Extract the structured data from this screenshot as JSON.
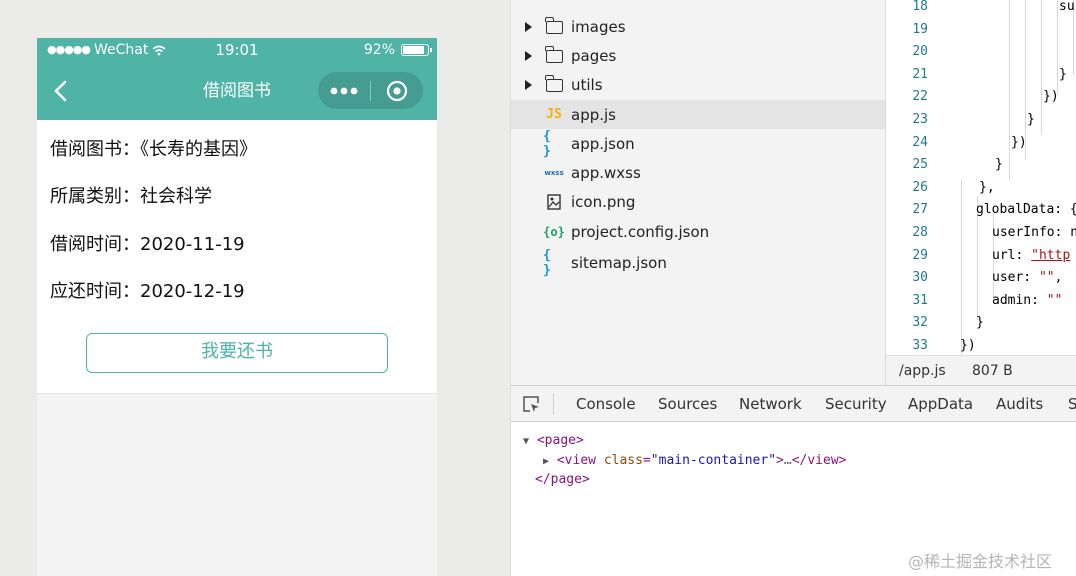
{
  "simulator": {
    "status_bar": {
      "carrier_dots": "●●●●●",
      "carrier": "WeChat",
      "time": "19:01",
      "battery_text": "92%",
      "battery_level": 0.92
    },
    "nav": {
      "title": "借阅图书"
    },
    "rows": [
      {
        "text": "借阅图书：《长寿的基因》"
      },
      {
        "text": "所属类别：社会科学"
      },
      {
        "text": "借阅时间：2020-11-19"
      },
      {
        "text": "应还时间：2020-12-19"
      }
    ],
    "return_button": "我要还书"
  },
  "file_tree": {
    "items": [
      {
        "label": "images",
        "type": "folder",
        "icon": "folder-icon"
      },
      {
        "label": "pages",
        "type": "folder",
        "icon": "folder-icon"
      },
      {
        "label": "utils",
        "type": "folder",
        "icon": "folder-icon"
      },
      {
        "label": "app.js",
        "type": "file",
        "icon": "js-file-icon",
        "icon_text": "JS",
        "selected": true
      },
      {
        "label": "app.json",
        "type": "file",
        "icon": "json-file-icon",
        "icon_text": "{ }"
      },
      {
        "label": "app.wxss",
        "type": "file",
        "icon": "wxss-file-icon",
        "icon_text": "wxss"
      },
      {
        "label": "icon.png",
        "type": "file",
        "icon": "image-file-icon"
      },
      {
        "label": "project.config.json",
        "type": "file",
        "icon": "config-file-icon",
        "icon_text": "{o}"
      },
      {
        "label": "sitemap.json",
        "type": "file",
        "icon": "json-file-icon",
        "icon_text": "{ }"
      }
    ]
  },
  "editor": {
    "lines": [
      {
        "num": "18",
        "parts": [
          {
            "t": "su",
            "c": ""
          }
        ]
      },
      {
        "num": "19",
        "parts": [
          {
            "t": "",
            "c": ""
          }
        ]
      },
      {
        "num": "20",
        "parts": [
          {
            "t": "",
            "c": ""
          }
        ]
      },
      {
        "num": "21",
        "parts": [
          {
            "t": "}",
            "c": ""
          }
        ]
      },
      {
        "num": "22",
        "parts": [
          {
            "t": "})",
            "c": ""
          }
        ]
      },
      {
        "num": "23",
        "parts": [
          {
            "t": "}",
            "c": ""
          }
        ]
      },
      {
        "num": "24",
        "parts": [
          {
            "t": "})",
            "c": ""
          }
        ]
      },
      {
        "num": "25",
        "parts": [
          {
            "t": "}",
            "c": ""
          }
        ]
      },
      {
        "num": "26",
        "parts": [
          {
            "t": "},",
            "c": ""
          }
        ]
      },
      {
        "num": "27",
        "parts": [
          {
            "t": "globalData: {",
            "c": ""
          }
        ]
      },
      {
        "num": "28",
        "parts": [
          {
            "t": "userInfo: n",
            "c": ""
          }
        ]
      },
      {
        "num": "29",
        "parts": [
          {
            "t": "url: ",
            "c": ""
          },
          {
            "t": "\"http",
            "c": "url-str"
          }
        ]
      },
      {
        "num": "30",
        "parts": [
          {
            "t": "user: ",
            "c": ""
          },
          {
            "t": "\"\"",
            "c": "str"
          },
          {
            "t": ",",
            "c": ""
          }
        ]
      },
      {
        "num": "31",
        "parts": [
          {
            "t": "admin: ",
            "c": ""
          },
          {
            "t": "\"\"",
            "c": "str"
          }
        ]
      },
      {
        "num": "32",
        "parts": [
          {
            "t": "}",
            "c": ""
          }
        ]
      },
      {
        "num": "33",
        "parts": [
          {
            "t": "})",
            "c": ""
          }
        ]
      }
    ],
    "status": {
      "path": "/app.js",
      "size": "807 B"
    }
  },
  "devtools": {
    "tabs": [
      "Console",
      "Sources",
      "Network",
      "Security",
      "AppData",
      "Audits",
      "Sensor"
    ],
    "elements": {
      "page_open": "<page>",
      "view_open": "<view",
      "attr_name": "class",
      "attr_value": "\"main-container\"",
      "ellipsis": "…",
      "view_close": "</view>",
      "page_close": "</page>"
    }
  },
  "watermark": "@稀土掘金技术社区",
  "colors": {
    "accent": "#4fb3a5",
    "selected_row": "#e4e4e4",
    "line_number": "#237893",
    "tag": "#881280"
  }
}
